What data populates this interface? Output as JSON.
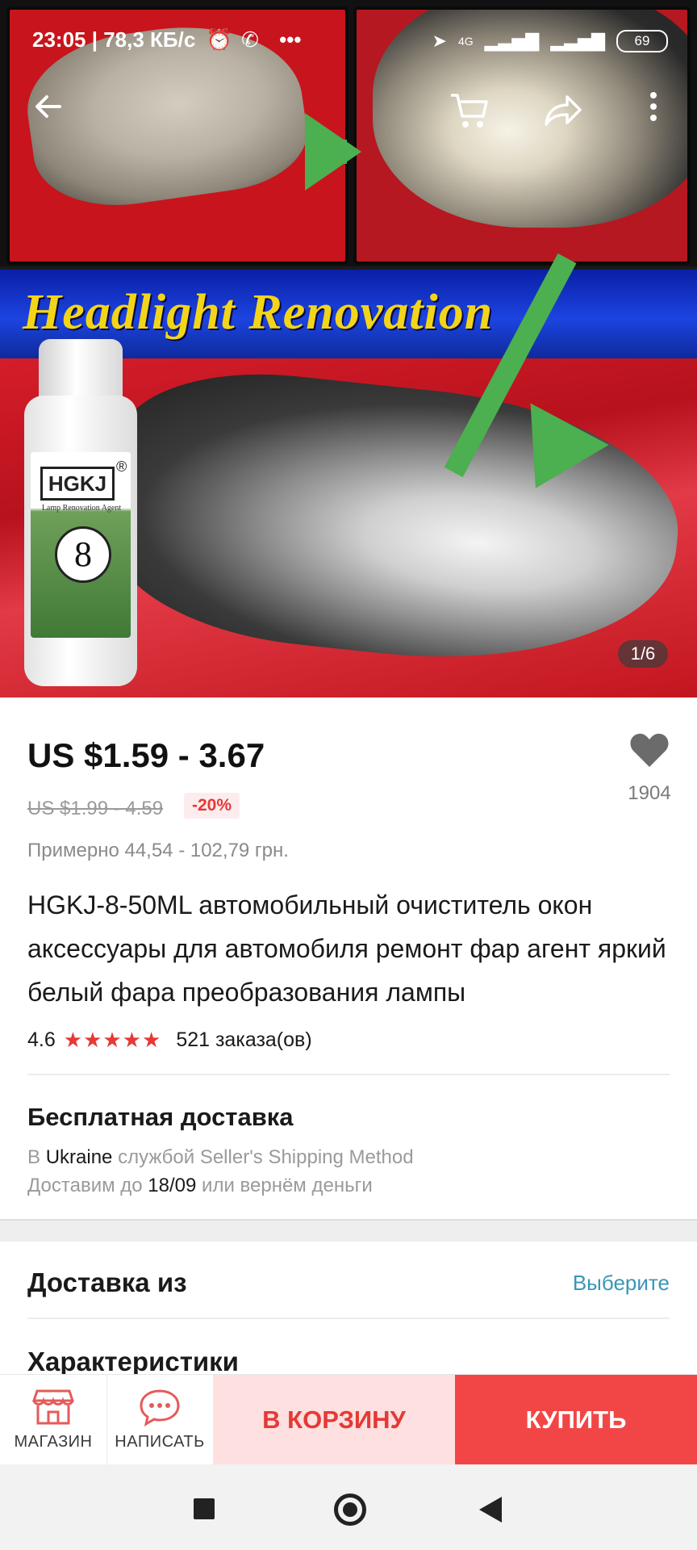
{
  "status_bar": {
    "time": "23:05 | 78,3 КБ/с",
    "network": "4G",
    "battery": "69"
  },
  "hero": {
    "banner_text": "Headlight Renovation",
    "bottle_brand": "HGKJ",
    "bottle_registered": "®",
    "bottle_subtitle": "Lamp Renovation Agent",
    "bottle_number": "8",
    "image_counter": "1/6"
  },
  "product": {
    "price": "US $1.59 - 3.67",
    "old_price": "US $1.99 - 4.59",
    "discount": "-20%",
    "approx_price": "Примерно 44,54 - 102,79 грн.",
    "title": "HGKJ-8-50ML автомобильный очиститель окон аксессуары для автомобиля ремонт фар агент яркий белый фара преобразования лампы",
    "rating": "4.6",
    "orders": "521 заказа(ов)",
    "favorites_count": "1904"
  },
  "shipping": {
    "title": "Бесплатная доставка",
    "line1_prefix": "В",
    "line1_country": "Ukraine",
    "line1_suffix": "службой Seller's Shipping Method",
    "line2_prefix": "Доставим до",
    "line2_date": "18/09",
    "line2_suffix": "или вернём деньги"
  },
  "sections": {
    "ship_from_label": "Доставка из",
    "ship_from_action": "Выберите",
    "specs_label": "Характеристики"
  },
  "action_bar": {
    "store_label": "МАГАЗИН",
    "message_label": "НАПИСАТЬ",
    "cart_label": "В КОРЗИНУ",
    "buy_label": "КУПИТЬ"
  },
  "icons": {
    "back": "arrow-left-icon",
    "cart": "cart-icon",
    "share": "share-icon",
    "more": "more-vertical-icon",
    "favorite": "heart-icon",
    "store": "store-icon",
    "message": "chat-icon"
  },
  "colors": {
    "accent": "#f24646",
    "cart_bg": "#fde0df",
    "link": "#3a96b8",
    "star": "#e53935"
  }
}
